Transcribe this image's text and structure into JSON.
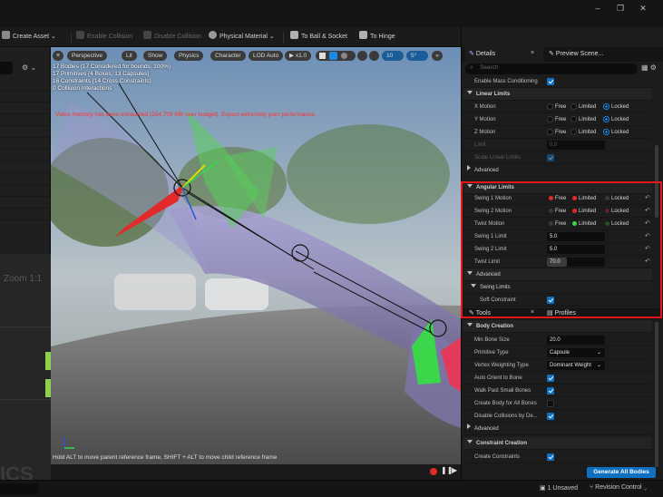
{
  "toolbar": {
    "create_asset": "Create Asset",
    "enable_collision": "Enable Collision",
    "disable_collision": "Disable Collision",
    "physical_material": "Physical Material",
    "to_ball_socket": "To Ball & Socket",
    "to_hinge": "To Hinge",
    "more_chevron": "»"
  },
  "window": {
    "minimize": "–",
    "restore": "❐",
    "close": "✕"
  },
  "left_panel": {
    "zoom_text": "Zoom 1:1",
    "watermark": "ICS",
    "settings_icon": "⚙"
  },
  "viewport": {
    "perspective": "Perspective",
    "lit": "Lit",
    "show": "Show",
    "physics": "Physics",
    "character": "Character",
    "lod": "LOD Auto",
    "play_speed": "x1.0",
    "grid_value": "10",
    "angle_value": "5°",
    "stats": [
      "17 Bodies (17 Considered for bounds, 100%)",
      "17 Primitives (4 Boxes, 13 Capsules)",
      "16 Constraints (14 Cross Constraints)",
      "0 Collision Interactions"
    ],
    "warning": "Video memory has been exhausted (254.709 MB over budget). Expect extremely poor performance.",
    "hint": "Hold ALT to move parent reference frame, SHIFT + ALT to move child reference frame"
  },
  "details": {
    "tab_details": "Details",
    "tab_preview": "Preview Scene...",
    "search_placeholder": "Search",
    "enable_mass_conditioning": "Enable Mass Conditioning",
    "linear_limits_header": "Linear Limits",
    "x_motion": "X Motion",
    "y_motion": "Y Motion",
    "z_motion": "Z Motion",
    "free": "Free",
    "limited": "Limited",
    "locked": "Locked",
    "limit": "Limit",
    "limit_value": "0.0",
    "scale_linear_limits": "Scale Linear Limits",
    "advanced": "Advanced",
    "angular_limits_header": "Angular Limits",
    "swing1_motion": "Swing 1 Motion",
    "swing2_motion": "Swing 2 Motion",
    "twist_motion": "Twist Motion",
    "swing1_limit": "Swing 1 Limit",
    "swing1_limit_value": "5.0",
    "swing2_limit": "Swing 2 Limit",
    "swing2_limit_value": "5.0",
    "twist_limit": "Twist Limit",
    "twist_limit_value": "70.0",
    "advanced2": "Advanced",
    "swing_limits": "Swing Limits",
    "soft_constraint": "Soft Constraint"
  },
  "tools": {
    "tab_tools": "Tools",
    "tab_profiles": "Profiles",
    "body_creation_header": "Body Creation",
    "min_bone_size": "Min Bone Size",
    "min_bone_size_value": "20.0",
    "primitive_type": "Primitive Type",
    "primitive_type_value": "Capsule",
    "vertex_weighting_type": "Vertex Weighting Type",
    "vertex_weighting_value": "Dominant Weight",
    "auto_orient": "Auto Orient to Bone",
    "walk_past_small": "Walk Past Small Bones",
    "create_body_all": "Create Body for All Bones",
    "disable_collisions": "Disable Collisions by De...",
    "advanced": "Advanced",
    "constraint_creation_header": "Constraint Creation",
    "create_constraints": "Create Constraints",
    "generate_all_bodies": "Generate All Bodies"
  },
  "status": {
    "unsaved": "1 Unsaved",
    "revision_control": "Revision Control"
  },
  "colors": {
    "accent": "#0e70c0",
    "highlight": "#e8151b",
    "warning": "#ff3030"
  }
}
